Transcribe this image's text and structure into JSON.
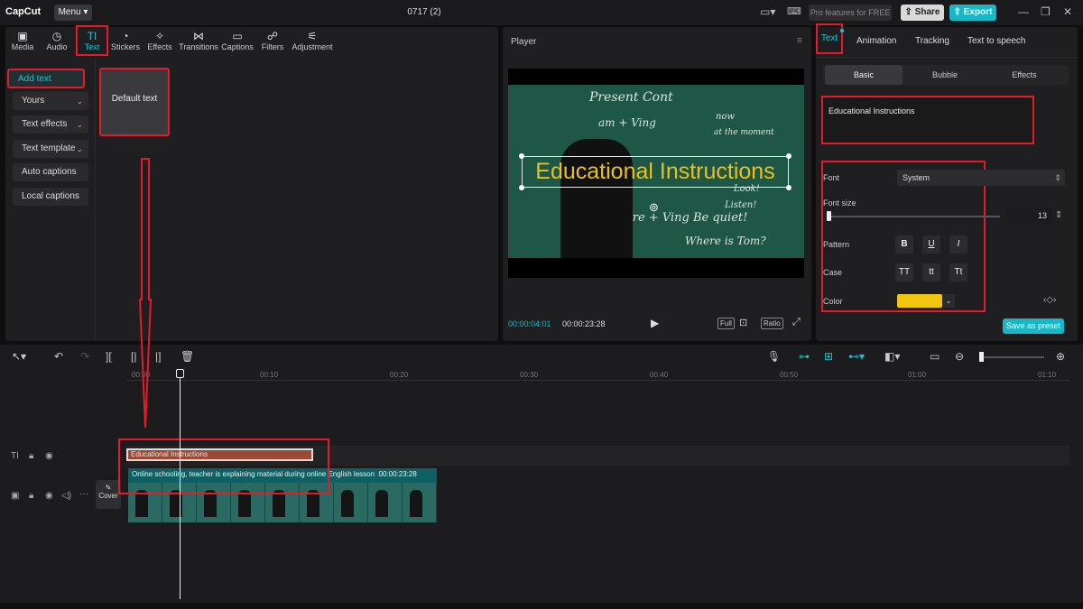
{
  "app": {
    "logo": "CapCut",
    "menu_label": "Menu",
    "doc_title": "0717 (2)",
    "pro_label": "Pro features for FREE",
    "share_label": "Share",
    "export_label": "Export"
  },
  "toolbar": {
    "items": [
      {
        "label": "Media",
        "icon": "media-icon"
      },
      {
        "label": "Audio",
        "icon": "audio-icon"
      },
      {
        "label": "Text",
        "icon": "text-icon"
      },
      {
        "label": "Stickers",
        "icon": "stickers-icon"
      },
      {
        "label": "Effects",
        "icon": "effects-icon"
      },
      {
        "label": "Transitions",
        "icon": "transitions-icon"
      },
      {
        "label": "Captions",
        "icon": "captions-icon"
      },
      {
        "label": "Filters",
        "icon": "filters-icon"
      },
      {
        "label": "Adjustment",
        "icon": "adjustment-icon"
      }
    ],
    "active": "Text"
  },
  "sidebar": {
    "items": [
      {
        "label": "Add text"
      },
      {
        "label": "Yours"
      },
      {
        "label": "Text effects"
      },
      {
        "label": "Text template"
      },
      {
        "label": "Auto captions"
      },
      {
        "label": "Local captions"
      }
    ]
  },
  "default_card": {
    "label": "Default text"
  },
  "player": {
    "title": "Player",
    "overlay_text": "Educational Instructions",
    "current_time": "00:00:04:01",
    "total_time": "00:00:23:28",
    "full_label": "Full",
    "ratio_label": "Ratio",
    "board_lines": [
      "Present Cont",
      "am + Ving",
      "now",
      "at the moment",
      "Look!",
      "Listen!",
      "are + Ving  Be quiet!",
      "Where is Tom?"
    ]
  },
  "inspector": {
    "tabs": [
      "Text",
      "Animation",
      "Tracking",
      "Text to speech"
    ],
    "active_tab": "Text",
    "subtabs": [
      "Basic",
      "Bubble",
      "Effects"
    ],
    "active_subtab": "Basic",
    "text_value": "Educational Instructions",
    "font_label": "Font",
    "font_value": "System",
    "font_size_label": "Font size",
    "font_size_value": "13",
    "pattern_label": "Pattern",
    "pattern_buttons": [
      "B",
      "U",
      "I"
    ],
    "case_label": "Case",
    "case_buttons": [
      "TT",
      "tt",
      "Tt"
    ],
    "color_label": "Color",
    "color_value": "#f2c50f",
    "save_preset_label": "Save as preset"
  },
  "timeline": {
    "ruler": [
      "00:00",
      "00:10",
      "00:20",
      "00:30",
      "00:40",
      "00:50",
      "01:00",
      "01:10"
    ],
    "text_clip": "Educational Instructions",
    "video_clip_label": "Online schooling, teacher is explaining material during online English lesson",
    "video_clip_duration": "00:00:23:28",
    "cover_label": "Cover"
  },
  "colors": {
    "accent": "#19c6d6",
    "highlight_red": "#e21c2a",
    "text_clip": "#9a4a35",
    "video_clip": "#0f5f63"
  }
}
